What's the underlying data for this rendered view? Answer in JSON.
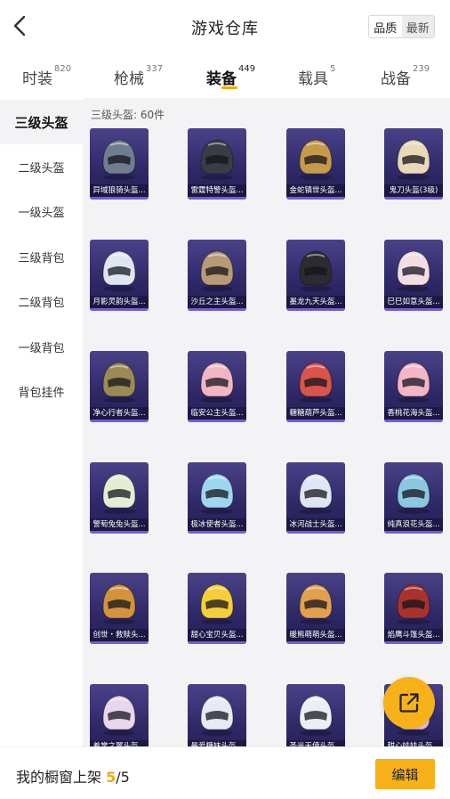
{
  "header": {
    "title": "游戏仓库",
    "sort_options": [
      "品质",
      "最新"
    ],
    "back_icon": "chevron-left-icon"
  },
  "tabs": [
    {
      "label": "时装",
      "count": "820"
    },
    {
      "label": "枪械",
      "count": "337"
    },
    {
      "label": "装备",
      "count": "449",
      "active": true
    },
    {
      "label": "载具",
      "count": "5"
    },
    {
      "label": "战备",
      "count": "239"
    }
  ],
  "sidebar": {
    "items": [
      "三级头盔",
      "二级头盔",
      "一级头盔",
      "三级背包",
      "二级背包",
      "一级背包",
      "背包挂件"
    ],
    "active_index": 0
  },
  "content": {
    "count_label": "三级头盔: 60件",
    "items": [
      {
        "name": "异域狼骑头盔...",
        "color": "#6f7e8c"
      },
      {
        "name": "雷霆特警头盔...",
        "color": "#3b3b44"
      },
      {
        "name": "金蛇镇世头盔...",
        "color": "#c79a4a"
      },
      {
        "name": "鬼刀头盔(3级)",
        "color": "#e8d9b8"
      },
      {
        "name": "月影灵韵头盔...",
        "color": "#dfe6f2"
      },
      {
        "name": "沙丘之主头盔...",
        "color": "#b89a76"
      },
      {
        "name": "墨龙九天头盔...",
        "color": "#2c2c30"
      },
      {
        "name": "巳巳如意头盔...",
        "color": "#f2dde3"
      },
      {
        "name": "净心行者头盔...",
        "color": "#9c8a55"
      },
      {
        "name": "临安公主头盔...",
        "color": "#f0b7c2"
      },
      {
        "name": "糖糖葫芦头盔...",
        "color": "#d9544b"
      },
      {
        "name": "香桃花海头盔...",
        "color": "#f3b6c6"
      },
      {
        "name": "警萄兔兔头盔...",
        "color": "#e6ecd3"
      },
      {
        "name": "极冰使者头盔...",
        "color": "#9fd6ef"
      },
      {
        "name": "冰河战士头盔...",
        "color": "#dde7f3"
      },
      {
        "name": "纯真浪花头盔...",
        "color": "#8cc7e0"
      },
      {
        "name": "创世・救赎头...",
        "color": "#d3933a"
      },
      {
        "name": "甜心宝贝头盔...",
        "color": "#f5cf3a"
      },
      {
        "name": "暖熊萌萌头盔...",
        "color": "#e0a04e"
      },
      {
        "name": "焰鹰斗篷头盔...",
        "color": "#a8332c"
      },
      {
        "name": "羞常之翼头盔...",
        "color": "#e8d6ec"
      },
      {
        "name": "最爱糖妹头盔...",
        "color": "#e6eaf3"
      },
      {
        "name": "圣光天使头盔...",
        "color": "#eceef5"
      },
      {
        "name": "甜心娃娃头盔...",
        "color": "#f3c4d0"
      }
    ]
  },
  "fab": {
    "icon": "share-export-icon"
  },
  "footer": {
    "label_prefix": "我的橱窗上架",
    "current": "5",
    "separator": "/",
    "total": "5",
    "edit_label": "编辑"
  },
  "colors": {
    "accent": "#f7b21a",
    "content_bg": "#f3f3f5",
    "card_bg": "#2e2866"
  }
}
